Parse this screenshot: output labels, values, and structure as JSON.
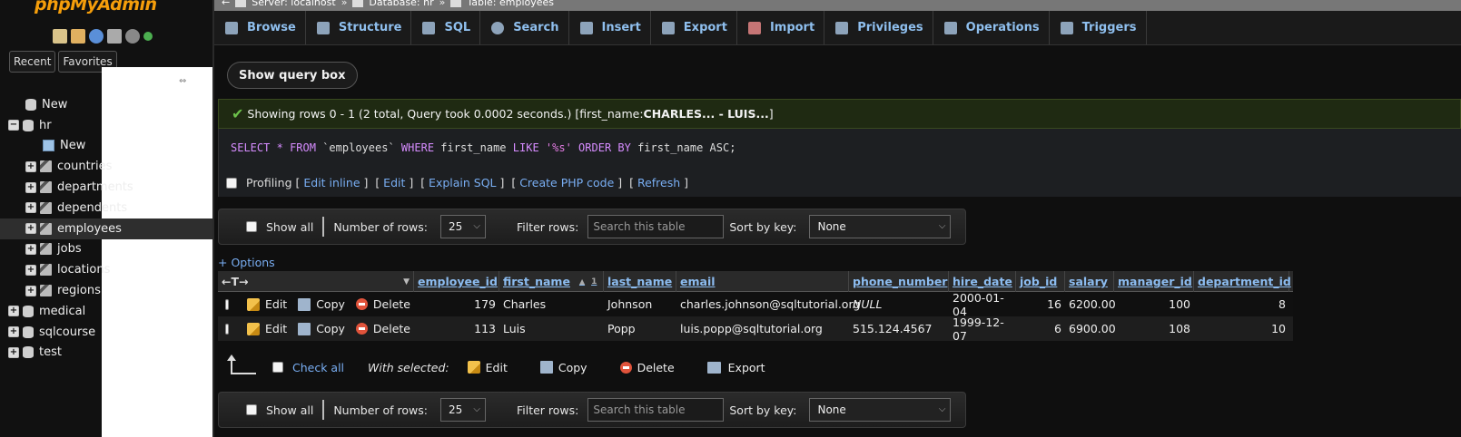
{
  "sidebar": {
    "logo_prefix": "php",
    "logo_suffix": "MyAdmin",
    "tab_recent": "Recent",
    "tab_favorites": "Favorites",
    "tree": [
      {
        "label": "New",
        "kind": "new-db",
        "indent": 1
      },
      {
        "label": "hr",
        "kind": "db",
        "indent": 0,
        "expanded": true
      },
      {
        "label": "New",
        "kind": "new-table",
        "indent": 2
      },
      {
        "label": "countries",
        "kind": "table",
        "indent": 1
      },
      {
        "label": "departments",
        "kind": "table",
        "indent": 1
      },
      {
        "label": "dependents",
        "kind": "table",
        "indent": 1
      },
      {
        "label": "employees",
        "kind": "table",
        "indent": 1,
        "active": true
      },
      {
        "label": "jobs",
        "kind": "table",
        "indent": 1
      },
      {
        "label": "locations",
        "kind": "table",
        "indent": 1
      },
      {
        "label": "regions",
        "kind": "table",
        "indent": 1
      },
      {
        "label": "medical",
        "kind": "db",
        "indent": 0
      },
      {
        "label": "sqlcourse",
        "kind": "db",
        "indent": 0
      },
      {
        "label": "test",
        "kind": "db",
        "indent": 0
      }
    ]
  },
  "breadcrumb": {
    "server": "Server: localhost",
    "database": "Database: hr",
    "table": "Table: employees",
    "sep": "»"
  },
  "menu": [
    "Browse",
    "Structure",
    "SQL",
    "Search",
    "Insert",
    "Export",
    "Import",
    "Privileges",
    "Operations",
    "Triggers"
  ],
  "main": {
    "show_query_label": "Show query box",
    "success_text": "Showing rows 0 - 1 (2 total, Query took 0.0002 seconds.) [first_name: ",
    "success_bold": "CHARLES... - LUIS...",
    "success_end": "]",
    "sql_select": "SELECT",
    "sql_star": "*",
    "sql_from": "FROM",
    "sql_table": "`employees`",
    "sql_where": "WHERE",
    "sql_col": "first_name",
    "sql_like": "LIKE",
    "sql_pattern": "'%s'",
    "sql_order": "ORDER BY",
    "sql_tail": "first_name ASC;",
    "profiling": "Profiling",
    "links": [
      "Edit inline",
      "Edit",
      "Explain SQL",
      "Create PHP code",
      "Refresh"
    ],
    "options_label": "+ Options"
  },
  "nav": {
    "show_all": "Show all",
    "num_rows_label": "Number of rows:",
    "num_rows_value": "25",
    "filter_label": "Filter rows:",
    "filter_placeholder": "Search this table",
    "sort_label": "Sort by key:",
    "sort_value": "None"
  },
  "table": {
    "headers": [
      "employee_id",
      "first_name",
      "last_name",
      "email",
      "phone_number",
      "hire_date",
      "job_id",
      "salary",
      "manager_id",
      "department_id"
    ],
    "sort_marker": "1",
    "edit": "Edit",
    "copy": "Copy",
    "delete": "Delete",
    "rows": [
      {
        "employee_id": "179",
        "first_name": "Charles",
        "last_name": "Johnson",
        "email": "charles.johnson@sqltutorial.org",
        "phone_number": "NULL",
        "hire_date": "2000-01-04",
        "job_id": "16",
        "salary": "6200.00",
        "manager_id": "100",
        "department_id": "8"
      },
      {
        "employee_id": "113",
        "first_name": "Luis",
        "last_name": "Popp",
        "email": "luis.popp@sqltutorial.org",
        "phone_number": "515.124.4567",
        "hire_date": "1999-12-07",
        "job_id": "6",
        "salary": "6900.00",
        "manager_id": "108",
        "department_id": "10"
      }
    ]
  },
  "bulk": {
    "check_all": "Check all",
    "with_selected": "With selected:",
    "edit": "Edit",
    "copy": "Copy",
    "delete": "Delete",
    "export": "Export"
  }
}
